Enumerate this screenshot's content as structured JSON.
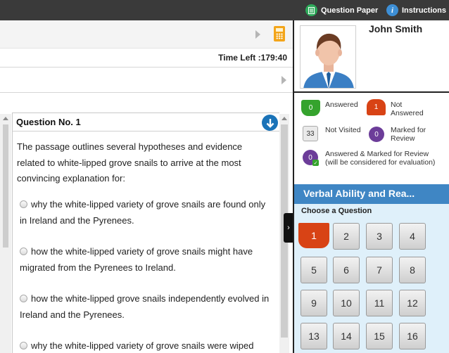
{
  "topbar": {
    "question_paper": "Question Paper",
    "instructions": "Instructions",
    "question_paper_icon": "document-icon",
    "instructions_icon": "info-icon",
    "instructions_glyph": "i"
  },
  "header": {
    "time_left": "Time Left :179:40"
  },
  "question": {
    "number_label": "Question No. 1",
    "text": "The passage outlines several hypotheses and evidence related to white-lipped grove snails to arrive at the most convincing explanation for:",
    "options": [
      "why the white-lipped variety of grove snails are found only in Ireland and the Pyrenees.",
      "how the white-lipped variety of grove snails might have migrated from the Pyrenees to Ireland.",
      "how the white-lipped grove snails independently evolved in Ireland and the Pyrenees.",
      "why the white-lipped variety of grove snails were wiped"
    ]
  },
  "candidate": {
    "name": "John Smith"
  },
  "legend": {
    "answered_count": "0",
    "answered_label": "Answered",
    "not_answered_count": "1",
    "not_answered_label": "Not Answered",
    "not_visited_count": "33",
    "not_visited_label": "Not Visited",
    "marked_count": "0",
    "marked_label": "Marked for Review",
    "answered_marked_count": "0",
    "answered_marked_label": "Answered & Marked for Review (will be considered for evaluation)"
  },
  "palette": {
    "section_title": "Verbal Ability and Rea...",
    "choose_label": "Choose a Question",
    "questions": [
      "1",
      "2",
      "3",
      "4",
      "5",
      "6",
      "7",
      "8",
      "9",
      "10",
      "11",
      "12",
      "13",
      "14",
      "15",
      "16"
    ],
    "current": "1"
  },
  "colors": {
    "topbar": "#3a3a3a",
    "answered": "#35a32d",
    "not_answered": "#d84315",
    "marked": "#6c3d99",
    "section": "#3f86c4",
    "palette_bg": "#dff0fa"
  }
}
